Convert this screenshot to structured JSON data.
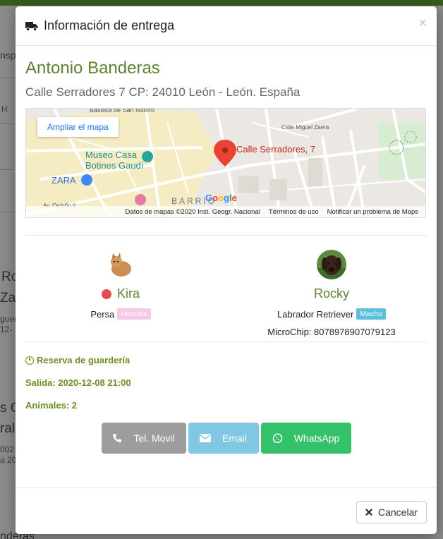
{
  "background": {
    "fragments": [
      "nsp",
      "H",
      "Ro",
      "Zar",
      "guerí",
      "12-",
      "s G",
      "ral",
      "002",
      "a 20",
      "nderas"
    ]
  },
  "modal": {
    "title": "Información de entrega",
    "close": "×",
    "client": {
      "name": "Antonio Banderas",
      "address": "Calle Serradores 7 CP: 24010 León - León. España"
    },
    "map": {
      "expand_label": "Ampliar el mapa",
      "marker_label": "Calle Serradores, 7",
      "labels": [
        "Museo Casa",
        "Botines Gaudí",
        "ZARA",
        "BARRIO",
        "Calle Miguel Zaera",
        "Av. Ordoño II",
        "Basílica de San Isidoro"
      ],
      "footer": {
        "data": "Datos de mapas ©2020 Inst. Geogr. Nacional",
        "terms": "Términos de uso",
        "report": "Notificar un problema de Maps"
      },
      "google": "Google"
    },
    "pets": [
      {
        "name": "Kira",
        "breed": "Persa",
        "sex": "Hembra",
        "has_alert_dot": true
      },
      {
        "name": "Rocky",
        "breed": "Labrador Retriever",
        "sex": "Macho",
        "microchip": "MicroChip: 8078978907079123"
      }
    ],
    "info": {
      "service": "Reserva de guardería",
      "departure": "Salida: 2020-12-08 21:00",
      "animals": "Animales: 2"
    },
    "buttons": {
      "tel": "Tel. Movil",
      "email": "Email",
      "whatsapp": "WhatsApp"
    },
    "footer": {
      "cancel": "Cancelar"
    }
  },
  "colors": {
    "accent": "#5f8130",
    "whatsapp": "#35c16a",
    "email": "#7fc7e2",
    "tel": "#9d9d9d",
    "female_badge": "#f7c8e7",
    "male_badge": "#5bc0de"
  }
}
